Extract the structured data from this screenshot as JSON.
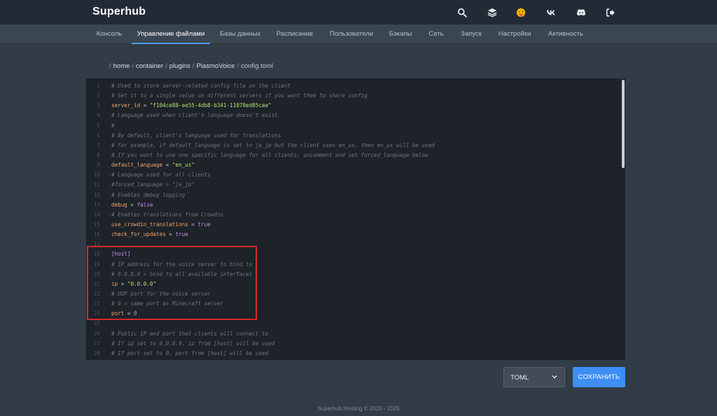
{
  "app": {
    "brand": "Superhub"
  },
  "header": {
    "icons": [
      "search-icon",
      "layers-icon",
      "avatar-emoji-icon",
      "vk-icon",
      "discord-icon",
      "sign-out-icon"
    ],
    "avatar_color": "#f5b400"
  },
  "nav": {
    "tabs": [
      {
        "label": "Консоль"
      },
      {
        "label": "Управление файлами",
        "active": true
      },
      {
        "label": "Базы данных"
      },
      {
        "label": "Расписание"
      },
      {
        "label": "Пользователи"
      },
      {
        "label": "Бэкапы"
      },
      {
        "label": "Сеть"
      },
      {
        "label": "Запуск"
      },
      {
        "label": "Настройки"
      },
      {
        "label": "Активность"
      }
    ]
  },
  "breadcrumb": {
    "separator": "/",
    "segments": [
      "home",
      "container",
      "plugins",
      "PlasmoVoice"
    ],
    "file": "config.toml"
  },
  "editor": {
    "lines": [
      {
        "n": "1",
        "t": "comment",
        "text": "# Used to store server-related config file on the client"
      },
      {
        "n": "2",
        "t": "comment",
        "text": "# Set it to a single value on different servers if you want them to share config"
      },
      {
        "n": "3",
        "t": "kv",
        "key": "server_id",
        "op": " = ",
        "vtype": "str",
        "val": "\"f104ce88-ee55-4db8-b341-11078ed85cae\""
      },
      {
        "n": "4",
        "t": "comment",
        "text": "# Language used when client's language doesn't exist"
      },
      {
        "n": "5",
        "t": "comment",
        "text": "#"
      },
      {
        "n": "6",
        "t": "comment",
        "text": "# By default, client's language used for translations"
      },
      {
        "n": "7",
        "t": "comment",
        "text": "# For example, if default_language is set to ja_jp but the client uses en_us, then en_us will be used"
      },
      {
        "n": "8",
        "t": "comment",
        "text": "# If you want to use one specific language for all clients, uncomment and set forced_language below"
      },
      {
        "n": "9",
        "t": "kv",
        "key": "default_language",
        "op": " = ",
        "vtype": "str",
        "val": "\"en_us\""
      },
      {
        "n": "10",
        "t": "comment",
        "text": "# Language used for all clients"
      },
      {
        "n": "11",
        "t": "comment",
        "text": "#forced_language = \"ja_jp\""
      },
      {
        "n": "12",
        "t": "comment",
        "text": "# Enables debug logging"
      },
      {
        "n": "13",
        "t": "kv",
        "key": "debug",
        "op": " = ",
        "vtype": "bool",
        "val": "false"
      },
      {
        "n": "14",
        "t": "comment",
        "text": "# Enables translations from Crowdin"
      },
      {
        "n": "15",
        "t": "kv",
        "key": "use_crowdin_translations",
        "op": " = ",
        "vtype": "bool",
        "val": "true"
      },
      {
        "n": "16",
        "t": "kv",
        "key": "check_for_updates",
        "op": " = ",
        "vtype": "bool",
        "val": "true"
      },
      {
        "n": "17",
        "t": "blank",
        "text": ""
      },
      {
        "n": "18",
        "t": "section",
        "text": "[host]"
      },
      {
        "n": "19",
        "t": "comment",
        "text": "# IP address for the voice server to bind to"
      },
      {
        "n": "20",
        "t": "comment",
        "text": "# 0.0.0.0 = bind to all available interfaces"
      },
      {
        "n": "21",
        "t": "kv",
        "key": "ip",
        "op": " = ",
        "vtype": "str",
        "val": "\"0.0.0.0\""
      },
      {
        "n": "22",
        "t": "comment",
        "text": "# UDP port for the voice server"
      },
      {
        "n": "23",
        "t": "comment",
        "text": "# 0 = same port as Minecraft server"
      },
      {
        "n": "24",
        "t": "kv",
        "key": "port",
        "op": " = ",
        "vtype": "num",
        "val": "0"
      },
      {
        "n": "25",
        "t": "blank",
        "text": ""
      },
      {
        "n": "26",
        "t": "comment",
        "text": "# Public IP and port that clients will connect to"
      },
      {
        "n": "27",
        "t": "comment",
        "text": "# If ip set to 0.0.0.0, ip from [host] will be used"
      },
      {
        "n": "28",
        "t": "comment",
        "text": "# If port set to 0, port from [host] will be used"
      }
    ],
    "highlight_color": "#d62828"
  },
  "controls": {
    "syntax_select": {
      "value": "TOML"
    },
    "save_label": "СОХРАНИТЬ",
    "accent": "#3d8ef5"
  },
  "footer": {
    "text": "Superhub Hosting © 2020 - 2026"
  }
}
